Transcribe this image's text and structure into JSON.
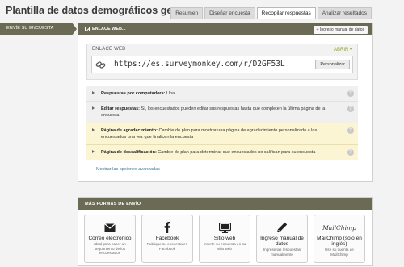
{
  "header": {
    "survey_title": "Plantilla de datos demográficos ge...",
    "tabs": [
      {
        "label": "Resumen",
        "active": false
      },
      {
        "label": "Diseñar encuesta",
        "active": false
      },
      {
        "label": "Recopilar respuestas",
        "active": true
      },
      {
        "label": "Analizar resultados",
        "active": false
      }
    ]
  },
  "sidebar": {
    "item": "ENVÍE SU ENCUESTA"
  },
  "collector": {
    "title": "ENLACE WEB...",
    "manual_entry": "+ Ingreso manual de datos",
    "web_link_label": "ENLACE WEB",
    "open_label": "ABRIR ▾",
    "url": "https://es.surveymonkey.com/r/D2GF53L",
    "customize_label": "Personalizar",
    "options": [
      {
        "label": "Respuestas por computadora:",
        "text": " Una",
        "link": "",
        "style": "grey"
      },
      {
        "label": "Editar respuestas:",
        "text": " Sí, los encuestados pueden editar sus respuestas hasta que completen la última página de la encuesta.",
        "link": "",
        "style": "grey"
      },
      {
        "label": "Página de agradecimiento:",
        "text": " Cambie de plan para mostrar una página de agradecimiento personalizada a los encuestados una vez que finalicen la encuesta",
        "link": "",
        "style": "yellow"
      },
      {
        "label": "Página de descalificación:",
        "text": " Cambie de plan para determinar qué encuestados no califican para su encuesta",
        "link": "",
        "style": "yellow"
      }
    ],
    "advanced_link": "Mostrar las opciones avanzadas"
  },
  "more_methods": {
    "title": "MÁS FORMAS DE ENVÍO",
    "cards": [
      {
        "icon": "envelope-icon",
        "name": "Correo electrónico",
        "desc": "Ideal para hacer un seguimiento de los encuestados"
      },
      {
        "icon": "facebook-icon",
        "name": "Facebook",
        "desc": "Publique su encuesta en Facebook"
      },
      {
        "icon": "monitor-icon",
        "name": "Sitio web",
        "desc": "Inserte su encuesta en su sitio web"
      },
      {
        "icon": "pencil-icon",
        "name": "Ingreso manual de datos",
        "desc": "Ingrese las respuestas manualmente"
      },
      {
        "icon": "mailchimp-logo",
        "logo_text": "MailChimp",
        "name": "MailChimp (solo en inglés)",
        "desc": "Use su cuenta de MailChimp"
      }
    ]
  },
  "colors": {
    "header_bar": "#6a6a55",
    "warning_bg": "#fcf5d4",
    "accent_green": "#8aaa20",
    "link_blue": "#3a7a9a"
  }
}
